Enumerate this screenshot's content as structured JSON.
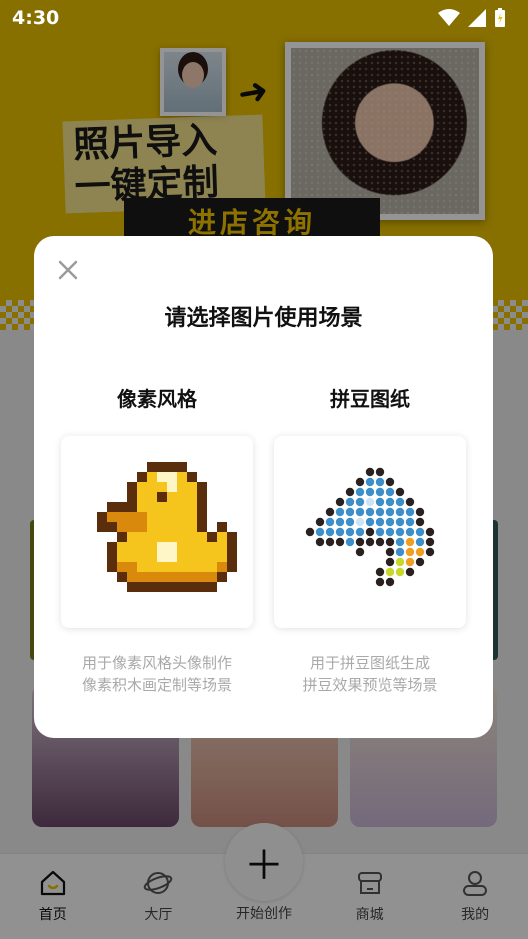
{
  "status_bar": {
    "time": "4:30"
  },
  "dialog": {
    "title": "请选择图片使用场景",
    "options": [
      {
        "title": "像素风格",
        "desc_line1": "用于像素风格头像制作",
        "desc_line2": "像素积木画定制等场景"
      },
      {
        "title": "拼豆图纸",
        "desc_line1": "用于拼豆图纸生成",
        "desc_line2": "拼豆效果预览等场景"
      }
    ]
  },
  "banner": {
    "title_line1": "照片导入",
    "title_line2": "一键定制",
    "consult": "进店咨询"
  },
  "bottom_nav": {
    "items": [
      {
        "label": "首页",
        "icon": "home-icon"
      },
      {
        "label": "大厅",
        "icon": "planet-icon"
      },
      {
        "label": "开始创作",
        "icon": "plus-icon"
      },
      {
        "label": "商城",
        "icon": "store-icon"
      },
      {
        "label": "我的",
        "icon": "profile-icon"
      }
    ]
  },
  "colors": {
    "accent": "#e8c000",
    "dialog_bg": "#ffffff",
    "muted_text": "#a9a9a9"
  }
}
